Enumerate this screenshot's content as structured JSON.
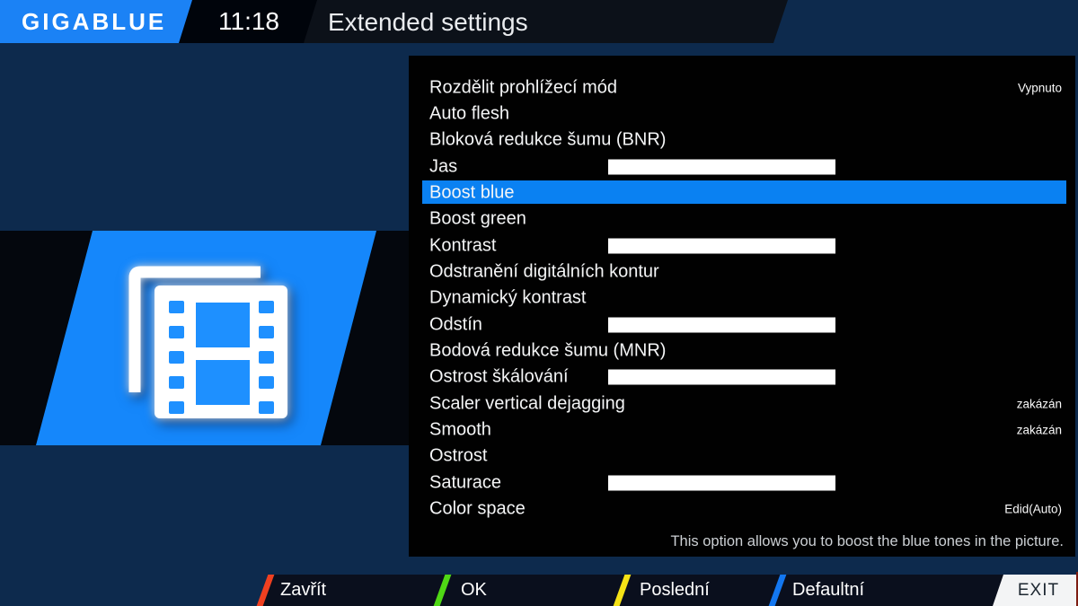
{
  "header": {
    "logo_text": "GIGABLUE",
    "clock": "11:18",
    "title": "Extended settings"
  },
  "menu": {
    "items": [
      {
        "label": "Rozdělit prohlížecí mód",
        "value": "Vypnuto"
      },
      {
        "label": "Auto flesh"
      },
      {
        "label": "Bloková redukce šumu (BNR)"
      },
      {
        "label": "Jas",
        "control": "slider"
      },
      {
        "label": "Boost blue",
        "selected": true
      },
      {
        "label": "Boost green"
      },
      {
        "label": "Kontrast",
        "control": "slider"
      },
      {
        "label": "Odstranění digitálních kontur"
      },
      {
        "label": "Dynamický kontrast"
      },
      {
        "label": "Odstín",
        "control": "slider"
      },
      {
        "label": "Bodová redukce šumu (MNR)"
      },
      {
        "label": "Ostrost škálování",
        "control": "slider"
      },
      {
        "label": "Scaler vertical dejagging",
        "value": "zakázán"
      },
      {
        "label": "Smooth",
        "value": "zakázán"
      },
      {
        "label": "Ostrost"
      },
      {
        "label": "Saturace",
        "control": "slider"
      },
      {
        "label": "Color space",
        "value": "Edid(Auto)"
      }
    ],
    "description": "This option allows you to boost the blue tones in the picture."
  },
  "footer": {
    "buttons": [
      {
        "color": "red",
        "label": "Zavřít"
      },
      {
        "color": "green",
        "label": "OK"
      },
      {
        "color": "yellow",
        "label": "Poslední"
      },
      {
        "color": "blue",
        "label": "Defaultní"
      }
    ],
    "exit_label": "EXIT"
  },
  "colors": {
    "accent_blue": "#1b82f5",
    "highlight_blue": "#0a81f2",
    "background_navy": "#0d2a4d",
    "panel_black": "#010101",
    "stripe_red": "#f04020",
    "stripe_green": "#4fd815",
    "stripe_yellow": "#f5e216",
    "stripe_blue": "#1377f0"
  }
}
